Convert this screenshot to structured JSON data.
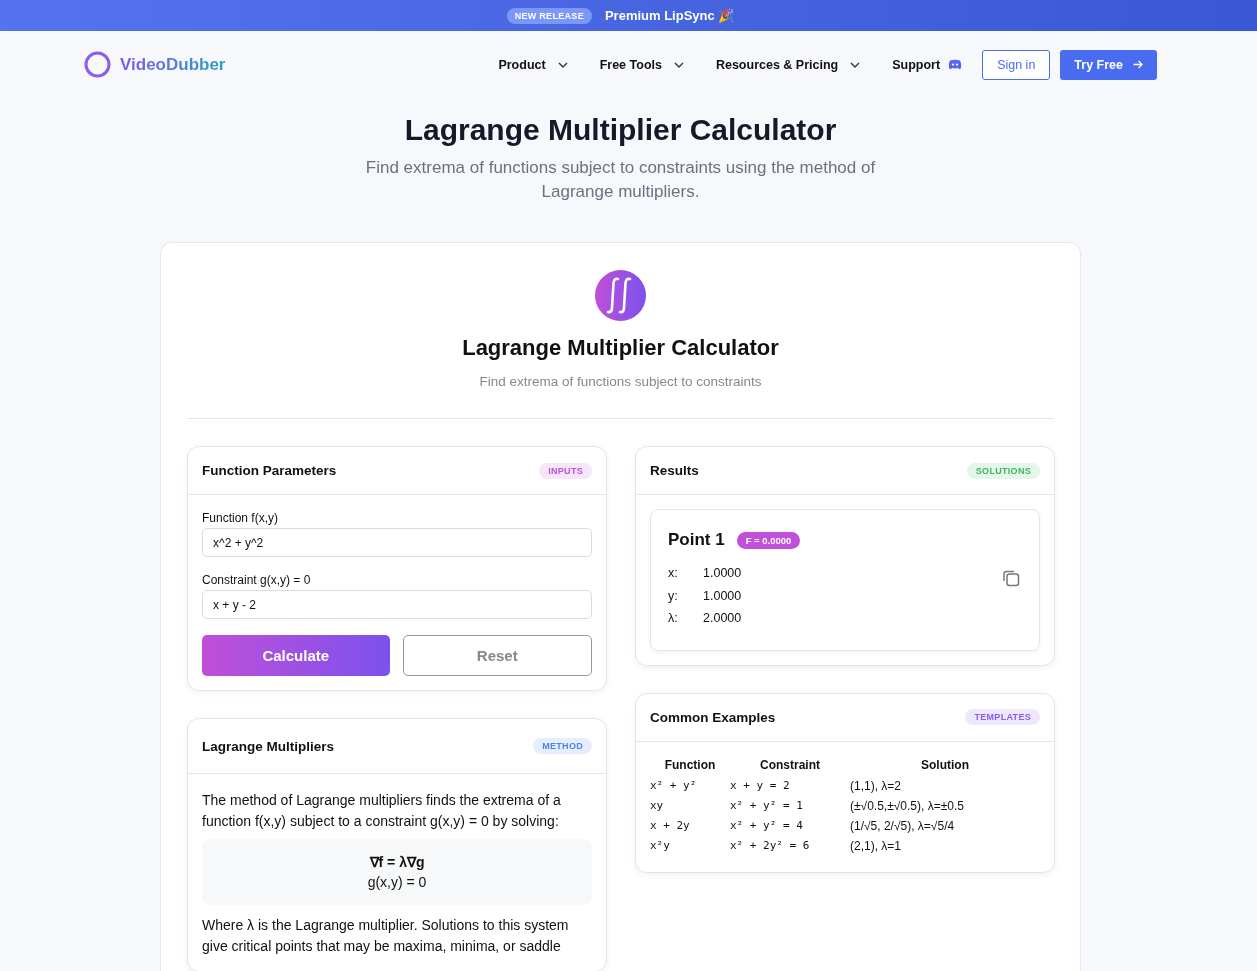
{
  "banner": {
    "badge": "NEW RELEASE",
    "text": "Premium LipSync 🎉"
  },
  "nav": {
    "brand": "VideoDubber",
    "items": [
      {
        "label": "Product",
        "kind": "dropdown"
      },
      {
        "label": "Free Tools",
        "kind": "dropdown"
      },
      {
        "label": "Resources & Pricing",
        "kind": "dropdown"
      },
      {
        "label": "Support",
        "kind": "chat"
      }
    ],
    "sign_in": "Sign in",
    "try_free": "Try Free"
  },
  "hero": {
    "title": "Lagrange Multiplier Calculator",
    "subtitle": "Find extrema of functions subject to constraints using the method of Lagrange multipliers."
  },
  "calculator": {
    "title": "Lagrange Multiplier Calculator",
    "subtitle": "Find extrema of functions subject to constraints",
    "parameters": {
      "title": "Function Parameters",
      "badge": {
        "text": "INPUTS",
        "color": "#c04fd9"
      },
      "fields": [
        {
          "label": "Function f(x,y)",
          "value": "x^2 + y^2"
        },
        {
          "label": "Constraint g(x,y) = 0",
          "value": "x + y - 2"
        }
      ],
      "buttons": [
        {
          "label": "Calculate",
          "kind": "primary"
        },
        {
          "label": "Reset",
          "kind": "secondary"
        }
      ]
    },
    "method": {
      "title": "Lagrange Multipliers",
      "badge": {
        "text": "METHOD",
        "color": "#4a86e8"
      },
      "intro": "The method of Lagrange multipliers finds the extrema of a function f(x,y) subject to a constraint g(x,y) = 0 by solving:",
      "equations": [
        {
          "text": "∇f = λ∇g",
          "kind": "main"
        },
        {
          "text": "g(x,y) = 0",
          "kind": "condition"
        }
      ],
      "outro": "Where λ is the Lagrange multiplier. Solutions to this system give critical points that may be maxima, minima, or saddle"
    },
    "results": {
      "title": "Results",
      "badge": {
        "text": "SOLUTIONS",
        "color": "#3fb55f"
      },
      "points": [
        {
          "title": "Point 1",
          "value": "F = 0.0000",
          "rows": [
            {
              "label": "x:",
              "value": "1.0000"
            },
            {
              "label": "y:",
              "value": "1.0000"
            },
            {
              "label": "λ:",
              "value": "2.0000"
            }
          ]
        }
      ]
    },
    "examples": {
      "title": "Common Examples",
      "badge": {
        "text": "TEMPLATES",
        "color": "#8a5cf0"
      },
      "columns": [
        "Function",
        "Constraint",
        "Solution"
      ],
      "rows": [
        [
          "x² + y²",
          "x + y = 2",
          "(1,1), λ=2"
        ],
        [
          "xy",
          "x² + y² = 1",
          "(±√0.5,±√0.5), λ=±0.5"
        ],
        [
          "x + 2y",
          "x² + y² = 4",
          "(1/√5, 2/√5), λ=√5/4"
        ],
        [
          "x²y",
          "x² + 2y² = 6",
          "(2,1), λ=1"
        ]
      ]
    }
  }
}
